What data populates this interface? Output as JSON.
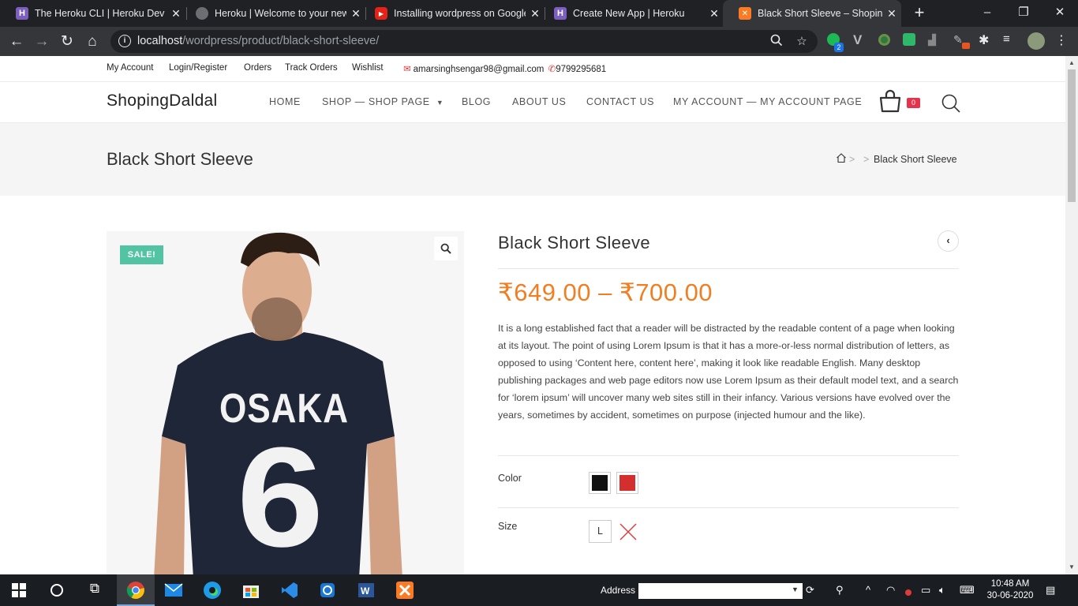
{
  "browser": {
    "tabs": [
      {
        "title": "The Heroku CLI | Heroku Dev C",
        "icon": "heroku-icon"
      },
      {
        "title": "Heroku | Welcome to your new",
        "icon": "globe-icon"
      },
      {
        "title": "Installing wordpress on Google",
        "icon": "youtube-icon"
      },
      {
        "title": "Create New App | Heroku",
        "icon": "heroku-icon"
      },
      {
        "title": "Black Short Sleeve – ShopingD",
        "icon": "xampp-icon"
      }
    ],
    "url_host": "localhost",
    "url_path": "/wordpress/product/black-short-sleeve/",
    "extension_badge": "2"
  },
  "site": {
    "top_links": [
      "My Account",
      "Login/Register",
      "Orders",
      "Track Orders",
      "Wishlist"
    ],
    "email": "amarsinghsengar98@gmail.com",
    "phone": "9799295681",
    "logo": "ShopingDaldal",
    "menu": [
      "HOME",
      "SHOP — SHOP PAGE",
      "BLOG",
      "ABOUT US",
      "CONTACT US",
      "MY ACCOUNT — MY ACCOUNT PAGE"
    ],
    "cart_count": "0"
  },
  "page_header": {
    "title": "Black Short Sleeve",
    "breadcrumb_sep1": ">",
    "breadcrumb_sep2": ">",
    "breadcrumb_current": "Black Short Sleeve"
  },
  "product": {
    "sale_badge": "SALE!",
    "shirt_text": "OSAKA",
    "shirt_number": "6",
    "title": "Black Short Sleeve",
    "price": "₹649.00 – ₹700.00",
    "description": "It is a long established fact that a reader will be distracted by the readable content of a page when looking at its layout. The point of using Lorem Ipsum is that it has a more-or-less normal distribution of letters, as opposed to using ‘Content here, content here’, making it look like readable English. Many desktop publishing packages and web page editors now use Lorem Ipsum as their default model text, and a search for ‘lorem ipsum’ will uncover many web sites still in their infancy. Various versions have evolved over the years, sometimes by accident, sometimes on purpose (injected humour and the like).",
    "color_label": "Color",
    "colors": [
      "#111111",
      "#d32f2f"
    ],
    "size_label": "Size",
    "sizes": [
      "L"
    ],
    "price_color": "#f07f23",
    "sale_color": "#52c4a4"
  },
  "taskbar": {
    "address_label": "Address",
    "time": "10:48 AM",
    "date": "30-06-2020"
  }
}
